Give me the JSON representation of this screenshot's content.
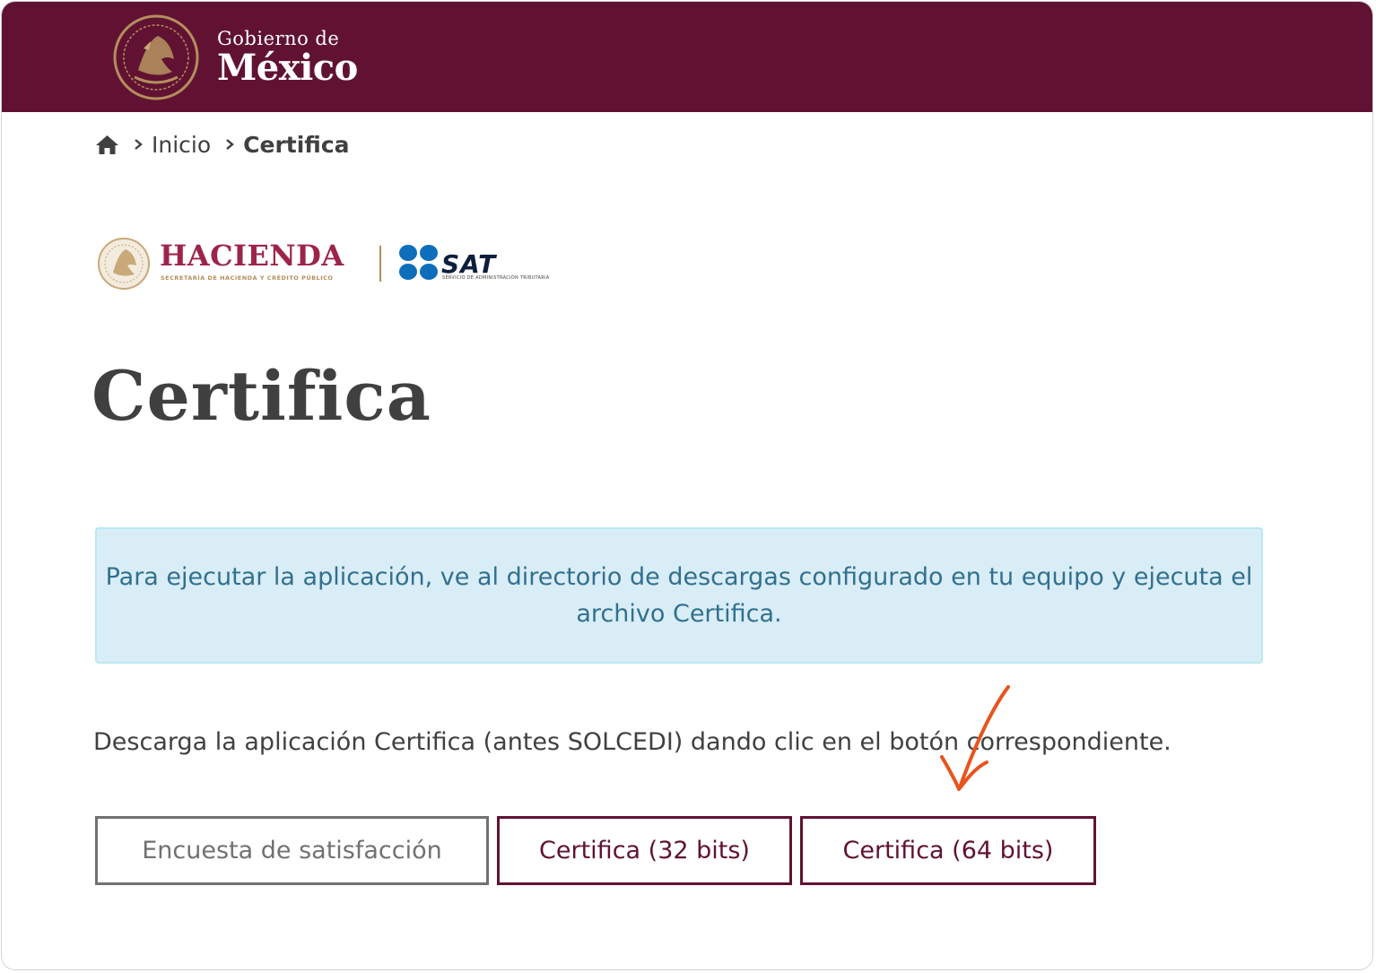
{
  "header": {
    "brand_line1": "Gobierno de",
    "brand_line2": "México",
    "seal_icon": "mexico-coat-of-arms-icon",
    "background_color": "#611232"
  },
  "breadcrumb": {
    "home_icon": "home-icon",
    "separator_icon": "chevron-right-icon",
    "items": [
      "Inicio",
      "Certifica"
    ]
  },
  "agency_logos": {
    "hacienda_name": "HACIENDA",
    "hacienda_subtitle": "SECRETARÍA DE HACIENDA Y CRÉDITO PÚBLICO",
    "sat_name": "SAT",
    "sat_subtitle": "SERVICIO DE ADMINISTRACIÓN TRIBUTARIA",
    "hacienda_color": "#9d2449",
    "sat_color": "#0d6ebc"
  },
  "page": {
    "title": "Certifica",
    "info_message": "Para ejecutar la aplicación, ve al directorio de descargas configurado en tu equipo y ejecuta el archivo Certifica.",
    "description": "Descarga la aplicación Certifica (antes SOLCEDI) dando clic en el botón correspondiente."
  },
  "buttons": {
    "survey": "Encuesta de satisfacción",
    "download_32": "Certifica (32 bits)",
    "download_64": "Certifica (64 bits)"
  },
  "annotation": {
    "arrow_icon": "hand-drawn-arrow-icon",
    "color": "#e8541e"
  }
}
